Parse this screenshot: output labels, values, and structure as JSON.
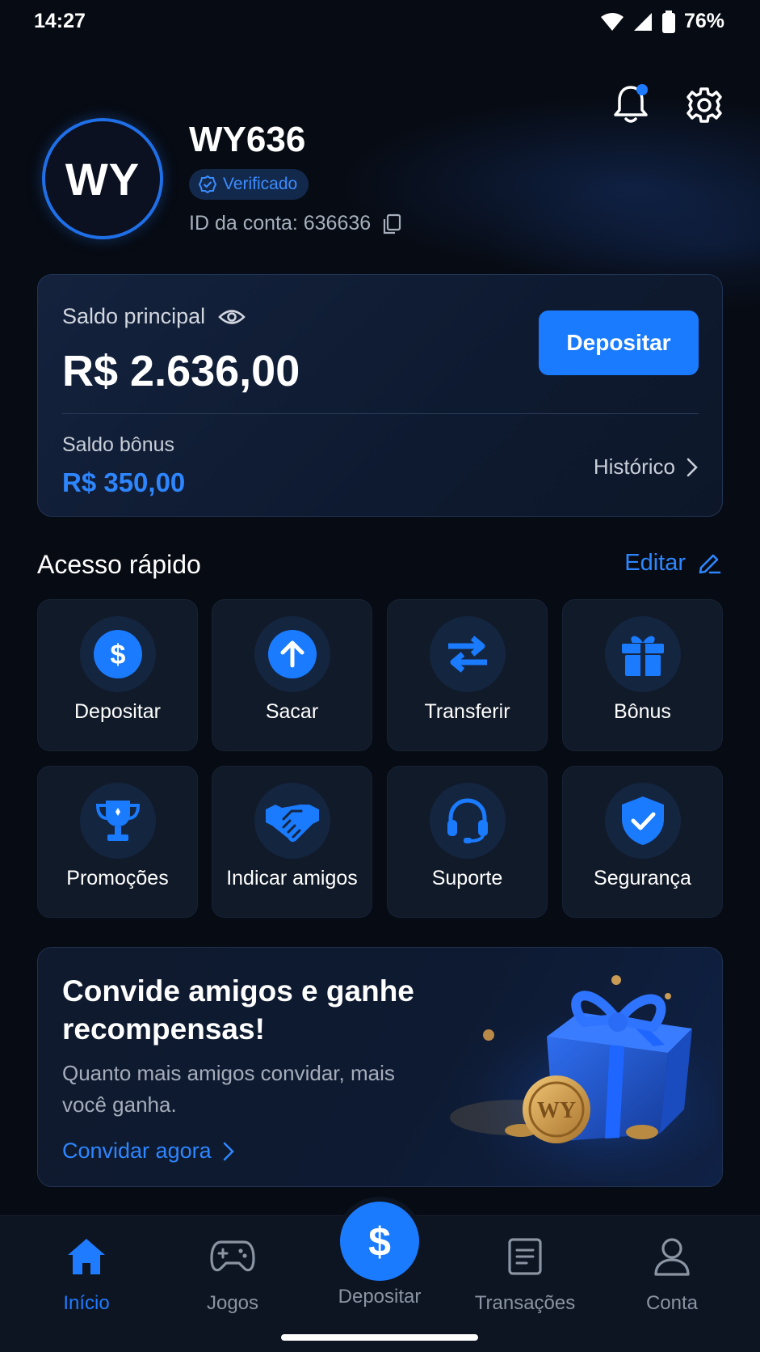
{
  "status_bar": {
    "time": "14:27",
    "battery": "76%"
  },
  "profile": {
    "initials": "WY",
    "username": "WY636",
    "verified_label": "Verificado",
    "account_id_label": "ID da conta: 636636"
  },
  "balance": {
    "main_label": "Saldo principal",
    "main_amount": "R$ 2.636,00",
    "deposit_button": "Depositar",
    "bonus_label": "Saldo bônus",
    "bonus_amount": "R$ 350,00",
    "history_link": "Histórico"
  },
  "quick_access": {
    "title": "Acesso rápido",
    "edit_label": "Editar",
    "items": [
      {
        "label": "Depositar",
        "icon": "dollar-icon"
      },
      {
        "label": "Sacar",
        "icon": "arrow-up-icon"
      },
      {
        "label": "Transferir",
        "icon": "transfer-icon"
      },
      {
        "label": "Bônus",
        "icon": "gift-icon"
      },
      {
        "label": "Promoções",
        "icon": "trophy-icon"
      },
      {
        "label": "Indicar amigos",
        "icon": "handshake-icon"
      },
      {
        "label": "Suporte",
        "icon": "headset-icon"
      },
      {
        "label": "Segurança",
        "icon": "shield-check-icon"
      }
    ]
  },
  "promo": {
    "title": "Convide amigos e ganhe recompensas!",
    "subtitle": "Quanto mais amigos convidar, mais você ganha.",
    "link": "Convidar agora",
    "coin_text": "WY"
  },
  "bottom_nav": {
    "items": [
      {
        "label": "Início",
        "icon": "home-icon",
        "active": true
      },
      {
        "label": "Jogos",
        "icon": "gamepad-icon"
      },
      {
        "label": "Depositar",
        "icon": "dollar-icon"
      },
      {
        "label": "Transações",
        "icon": "receipt-icon"
      },
      {
        "label": "Conta",
        "icon": "user-icon"
      }
    ]
  },
  "colors": {
    "accent": "#1a7bff",
    "background": "#070b13",
    "card": "#111a28"
  }
}
